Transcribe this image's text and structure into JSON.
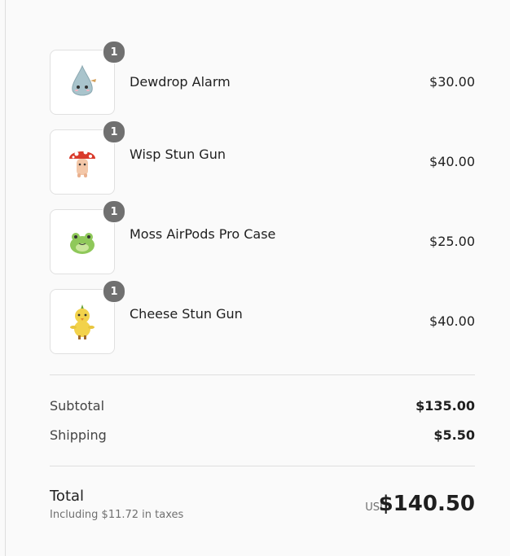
{
  "cart": {
    "items": [
      {
        "name": "Dewdrop Alarm",
        "quantity": "1",
        "price": "$30.00",
        "icon": "droplet-character-icon"
      },
      {
        "name": "Wisp Stun Gun",
        "quantity": "1",
        "price": "$40.00",
        "icon": "mushroom-character-icon"
      },
      {
        "name": "Moss AirPods Pro Case",
        "quantity": "1",
        "price": "$25.00",
        "icon": "frog-character-icon"
      },
      {
        "name": "Cheese Stun Gun",
        "quantity": "1",
        "price": "$40.00",
        "icon": "chick-character-icon"
      }
    ]
  },
  "summary": {
    "subtotal_label": "Subtotal",
    "subtotal_value": "$135.00",
    "shipping_label": "Shipping",
    "shipping_value": "$5.50",
    "total_label": "Total",
    "tax_note": "Including $11.72 in taxes",
    "currency": "USD",
    "total_value": "$140.50"
  },
  "colors": {
    "badge": "#707070",
    "background": "#fafafa",
    "divider": "#dedede"
  }
}
